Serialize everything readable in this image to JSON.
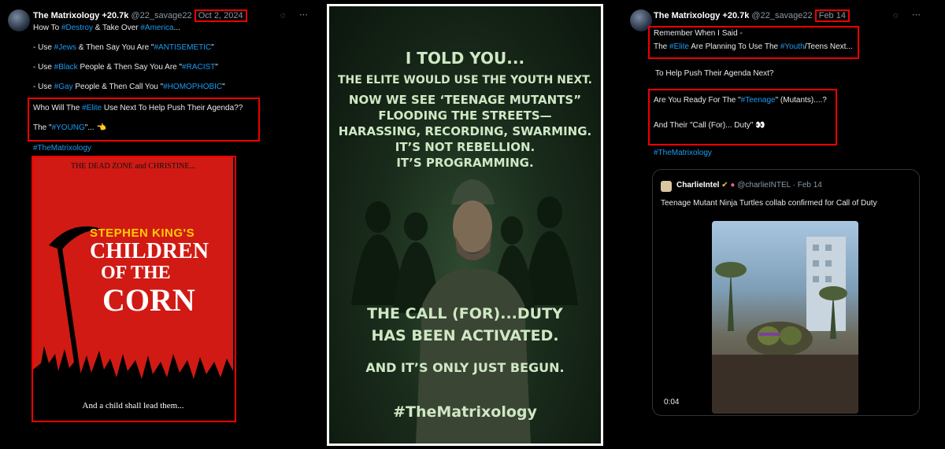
{
  "left_tweet": {
    "author": "The Matrixology +20.7k",
    "handle": "@22_savage22",
    "date": "Oct 2, 2024",
    "lines": [
      [
        "How To ",
        "#Destroy",
        " & Take Over ",
        "#America",
        "..."
      ],
      [
        "- Use ",
        "#Jews",
        " & Then Say You Are \"",
        "#ANTISEMETIC",
        "\""
      ],
      [
        "- Use ",
        "#Black",
        " People & Then Say You Are \"",
        "#RACIST",
        "\""
      ],
      [
        "- Use ",
        "#Gay",
        " People & Then Call You \"",
        "#HOMOPHOBIC",
        "\""
      ],
      [
        "Who Will The ",
        "#Elite",
        " Use Next To Help Push Their Agenda??"
      ],
      [
        "The \"",
        "#YOUNG",
        "\"... 👈"
      ]
    ],
    "hashtag": "#TheMatrixology",
    "poster": {
      "top_text": "THE DEAD ZONE and CHRISTINE...",
      "author_line": "STEPHEN KING'S",
      "title_1": "CHILDREN",
      "title_2": "OF THE",
      "title_3": "CORN",
      "bottom_text": "And a child shall lead them..."
    }
  },
  "center_image": {
    "lines": [
      "I TOLD YOU...",
      "THE ELITE WOULD USE THE YOUTH NEXT.",
      "NOW WE SEE ‘TEENAGE MUTANTS”",
      "FLOODING THE STREETS—",
      "HARASSING, RECORDING, SWARMING.",
      "IT’S NOT REBELLION.",
      "IT’S PROGRAMMING.",
      "THE CALL (FOR)...DUTY",
      "HAS BEEN ACTIVATED.",
      "AND IT’S ONLY JUST BEGUN.",
      "#TheMatrixology"
    ]
  },
  "right_tweet": {
    "author": "The Matrixology +20.7k",
    "handle": "@22_savage22",
    "date": "Feb 14",
    "lines": [
      [
        "Remember When I Said -"
      ],
      [
        "The ",
        "#Elite",
        " Are Planning To Use The ",
        "#Youth",
        "/Teens Next..."
      ],
      [
        "To Help Push Their Agenda Next?"
      ],
      [
        "Are You Ready For The \"",
        "#Teenage",
        "\" (Mutants)....?"
      ],
      [
        "And Their \"Call (For)... Duty\" 👀"
      ]
    ],
    "hashtag": "#TheMatrixology",
    "quote": {
      "author": "CharlieIntel",
      "handle": "@charlieINTEL",
      "date": "Feb 14",
      "text": "Teenage Mutant Ninja Turtles collab confirmed for Call of Duty",
      "video_time": "0:04"
    }
  },
  "colors": {
    "link": "#1d9bf0",
    "highlight": "#e00000",
    "poster_red": "#d11a14",
    "center_text": "#cfe8c4"
  }
}
